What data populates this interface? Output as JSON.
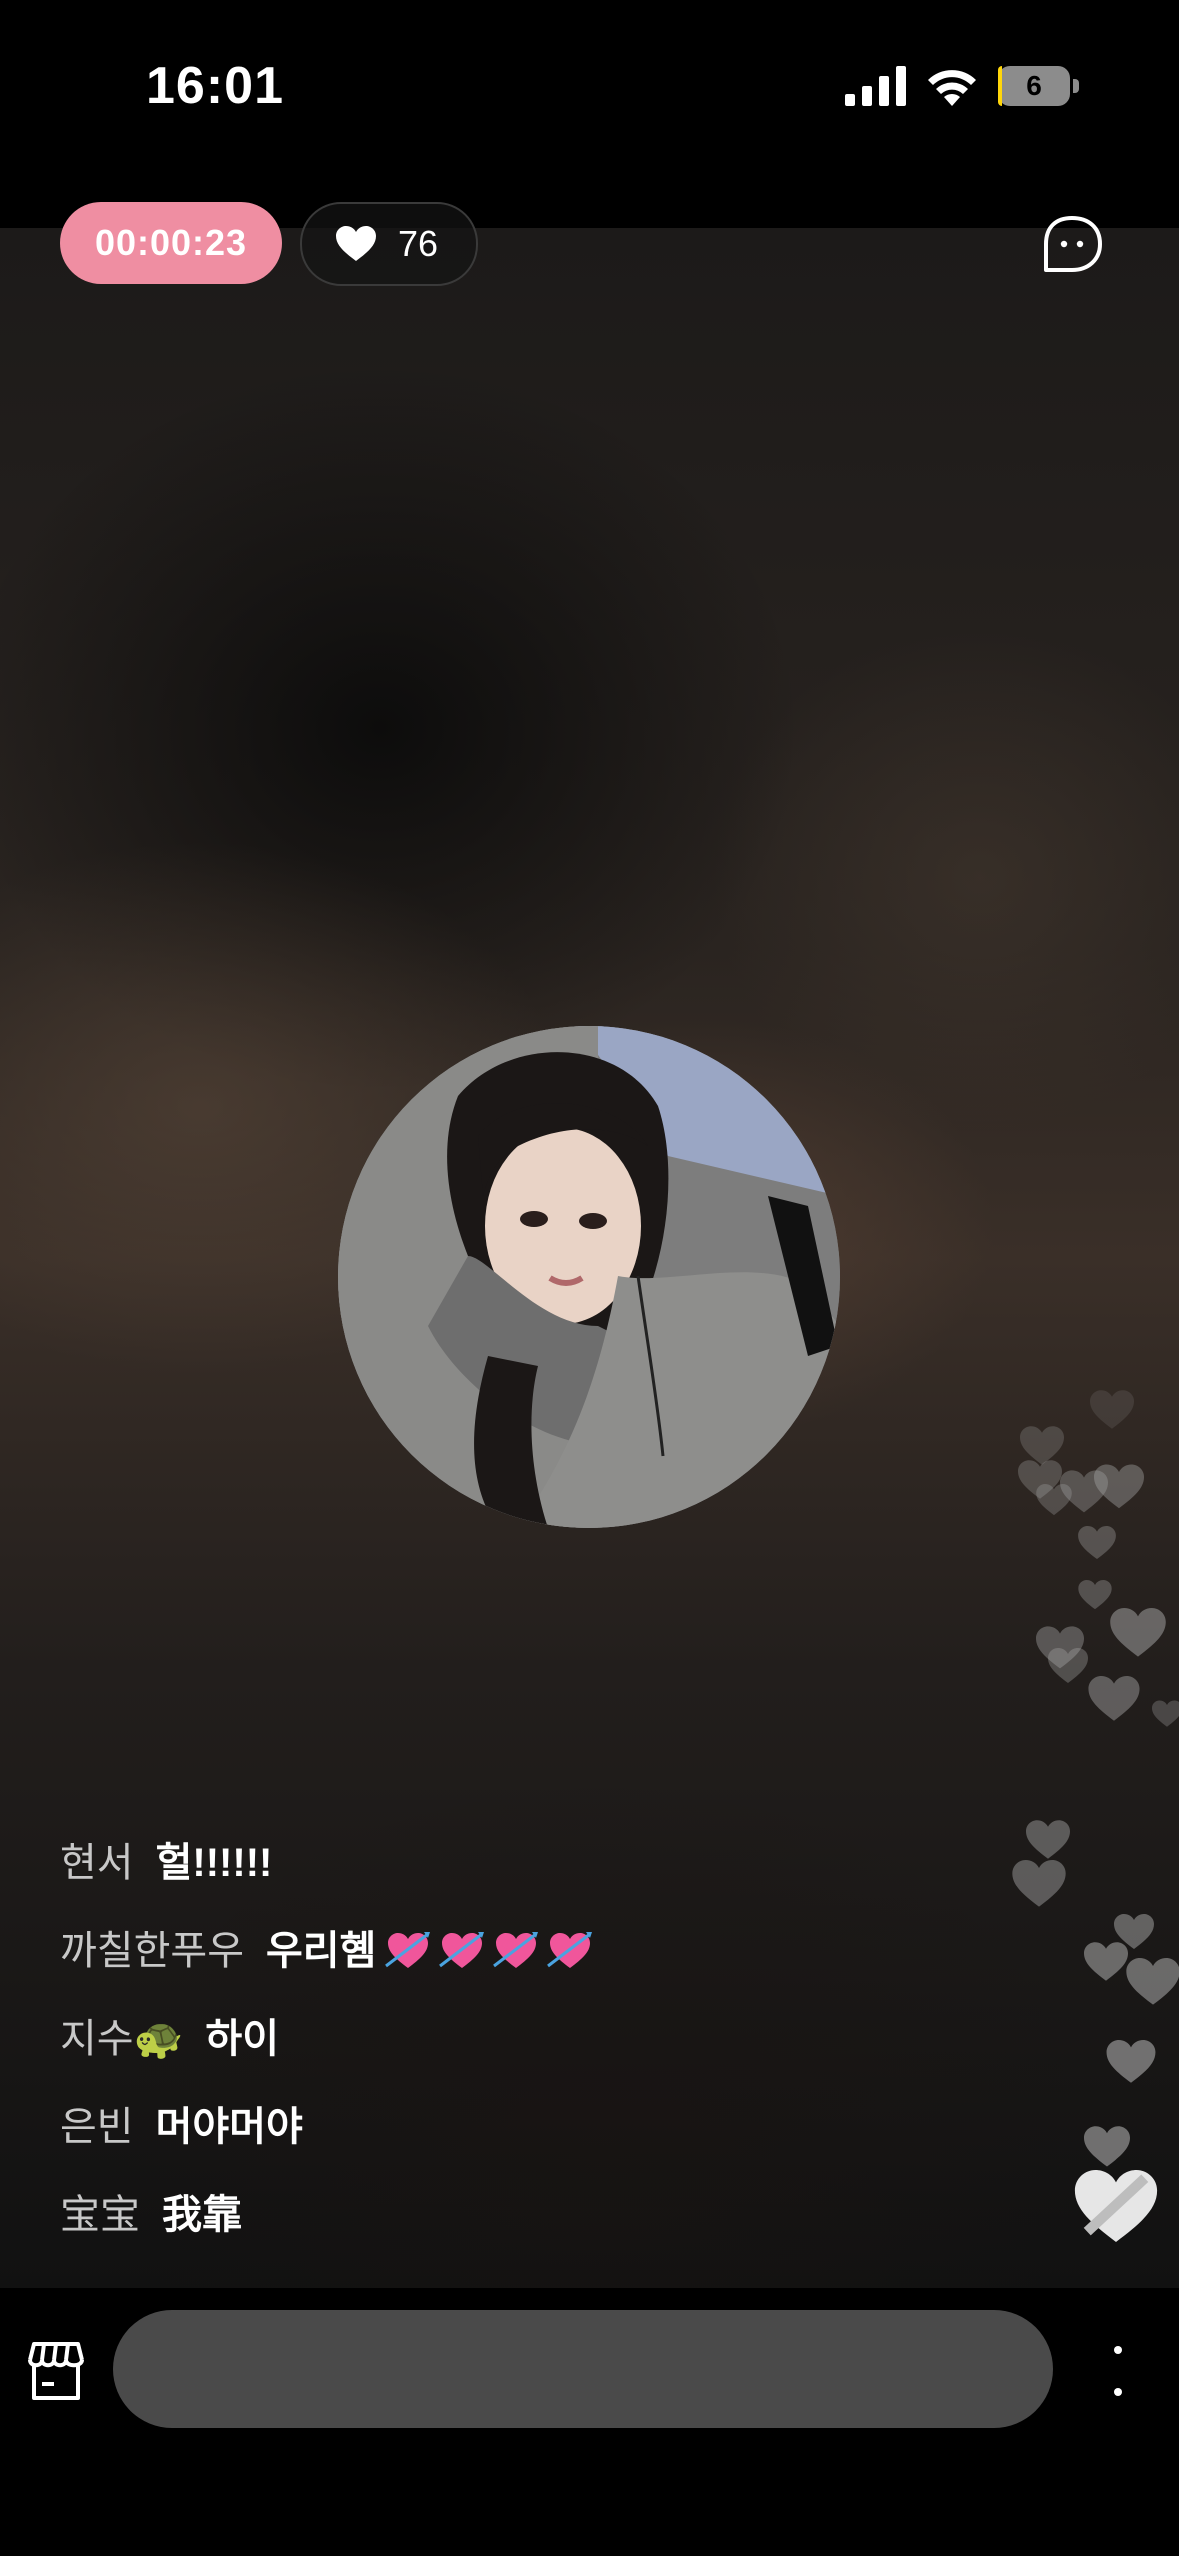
{
  "status_bar": {
    "time": "16:01",
    "battery_level": "6",
    "battery_fill_fraction": 0.06
  },
  "live": {
    "elapsed": "00:00:23",
    "likes": "76"
  },
  "comments": [
    {
      "user": "현서",
      "message": "헐!!!!!!"
    },
    {
      "user": "까칠한푸우",
      "message": "우리혬",
      "emoji": [
        "heart-with-arrow-icon",
        "heart-with-arrow-icon",
        "heart-with-arrow-icon",
        "heart-with-arrow-icon"
      ]
    },
    {
      "user": "지수🐢",
      "message": "하이"
    },
    {
      "user": "은빈",
      "message": "머야머야"
    },
    {
      "user": "宝宝",
      "message": "我靠"
    }
  ],
  "colors": {
    "timer_bg": "#ef8ea2",
    "input_bg": "#4a4a4a",
    "battery_low": "#ffd60a"
  },
  "icons": {
    "likes": "heart-icon",
    "chat": "chat-bubble-icon",
    "shop": "shop-icon",
    "more": "more-vertical-icon",
    "like_button": "heart-icon"
  }
}
